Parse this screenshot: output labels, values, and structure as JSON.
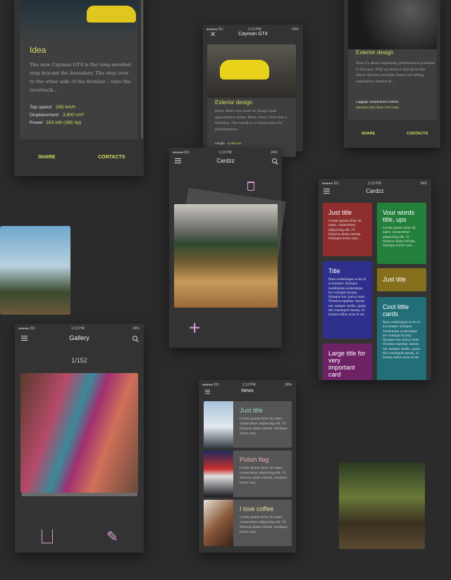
{
  "status": {
    "carrier": "●●●●● DU",
    "time": "1:13 PM",
    "battery": "24%"
  },
  "idea": {
    "title": "Idea",
    "text": "The new Cayman GT4 is the long-awaited step beyond the boundary. The step over to the other side of the frontier – onto the racetrack...",
    "specs": [
      {
        "label": "Top speed",
        "value": "295 km/h"
      },
      {
        "label": "Displacement",
        "value": "3,800 cm³"
      },
      {
        "label": "Power",
        "value": "283 kW (385 hp)"
      }
    ],
    "share": "SHARE",
    "contacts": "CONTACTS"
  },
  "cayman": {
    "header": "Cayman GT4",
    "title": "Exterior design",
    "text": "Here, there are more to things than appearance alone. Here, every form has a function. The result is a crucial plus for performance...",
    "spec_label": "Length",
    "spec_value": "4,438 mm",
    "contacts_peek": "CTS"
  },
  "interior": {
    "title": "Exterior design",
    "text": "Now it's about exploiting performance potential to the max. With an interior that gives the driver the best possible chance of setting superlative standards...",
    "spec_label": "Luggage compartment volume",
    "spec_value": "425 litres (150 l front / 275 l rear)",
    "share": "SHARE",
    "contacts": "CONTACTS"
  },
  "cardzz_stack": {
    "header": "Cardzz",
    "icons": [
      "menu-icon",
      "search-icon",
      "trash-icon",
      "plus-icon"
    ]
  },
  "cardzz_grid": {
    "header": "Cardzz",
    "cards": [
      {
        "title": "Just title",
        "text": "Lorem ipsum dolor sit amet, consectetur adipiscing elit. Ut rhoncus diam rutrum, tristique tortor non...",
        "color": "#8e2e2e"
      },
      {
        "title": "Vour words title, ups",
        "text": "Lorem ipsum dolor sit amet, consectetur adipiscing elit. Ut rhoncus diam rutrum, tristique tortor non...",
        "color": "#23803a"
      },
      {
        "title": "Title",
        "text": "Nam scelerisque ut mi et accumsan. Quisque vestibulum scelerisque leo volutpat lacinia. Quisque nec purus nunc. Vivamus egestas, massa nec semper mollis, quam dui consequat massa, id lacinia tellus urna et mi.",
        "color": "#2f2f8e"
      },
      {
        "title": "Just title",
        "text": "",
        "color": "#856f1c"
      },
      {
        "title": "Cool little cards",
        "text": "Nam scelerisque ut mi et accumsan. Quisque vestibulum scelerisque leo volutpat lacinia. Quisque nec purus nunc. Vivamus egestas, massa nec semper mollis, quam dui consequat massa, id lacinia tellus urna et mi.",
        "color": "#226f78"
      },
      {
        "title": "Large title for very important card",
        "text": "",
        "color": "#6e2266"
      }
    ]
  },
  "gallery": {
    "header": "Gallery",
    "counter": "1/152"
  },
  "news": {
    "header": "News",
    "items": [
      {
        "title": "Just title",
        "text": "Lorem ipsum dolor sit amet, consectetur adipiscing elit. Ut rhoncus diam rutrum, tristique tortor non...",
        "color": "#9fd0cc"
      },
      {
        "title": "Polish flag",
        "text": "Lorem ipsum dolor sit amet, consectetur adipiscing elit. Ut rhoncus diam rutrum, tristique tortor non...",
        "color": "#e0aab0"
      },
      {
        "title": "I love coffee",
        "text": "Lorem ipsum dolor sit amet, consectetur adipiscing elit. Ut rhoncus diam rutrum, tristique tortor non...",
        "color": "#e8dca0"
      }
    ]
  },
  "accent": "#d6dd63"
}
